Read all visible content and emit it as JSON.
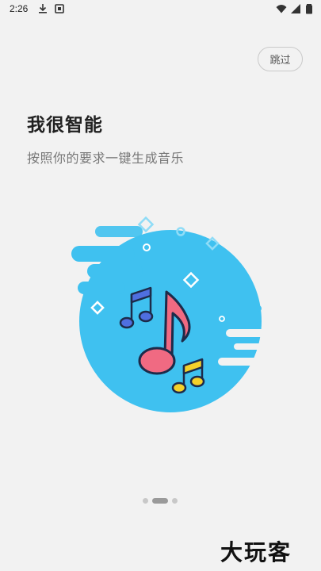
{
  "status_bar": {
    "time": "2:26",
    "icons": [
      "download-icon",
      "notification-icon",
      "wifi-icon",
      "signal-icon",
      "battery-icon"
    ]
  },
  "onboarding": {
    "skip_label": "跳过",
    "title": "我很智能",
    "subtitle": "按照你的要求一键生成音乐",
    "illustration_icon": "music-notes-icon",
    "page_count": 3,
    "active_page": 2
  },
  "colors": {
    "background": "#f2f2f2",
    "blob": "#3fc1f0",
    "note_red": "#f06a82",
    "note_blue": "#4f6fe0",
    "note_yellow": "#f5d12a"
  },
  "watermark": {
    "text": "大玩客"
  }
}
